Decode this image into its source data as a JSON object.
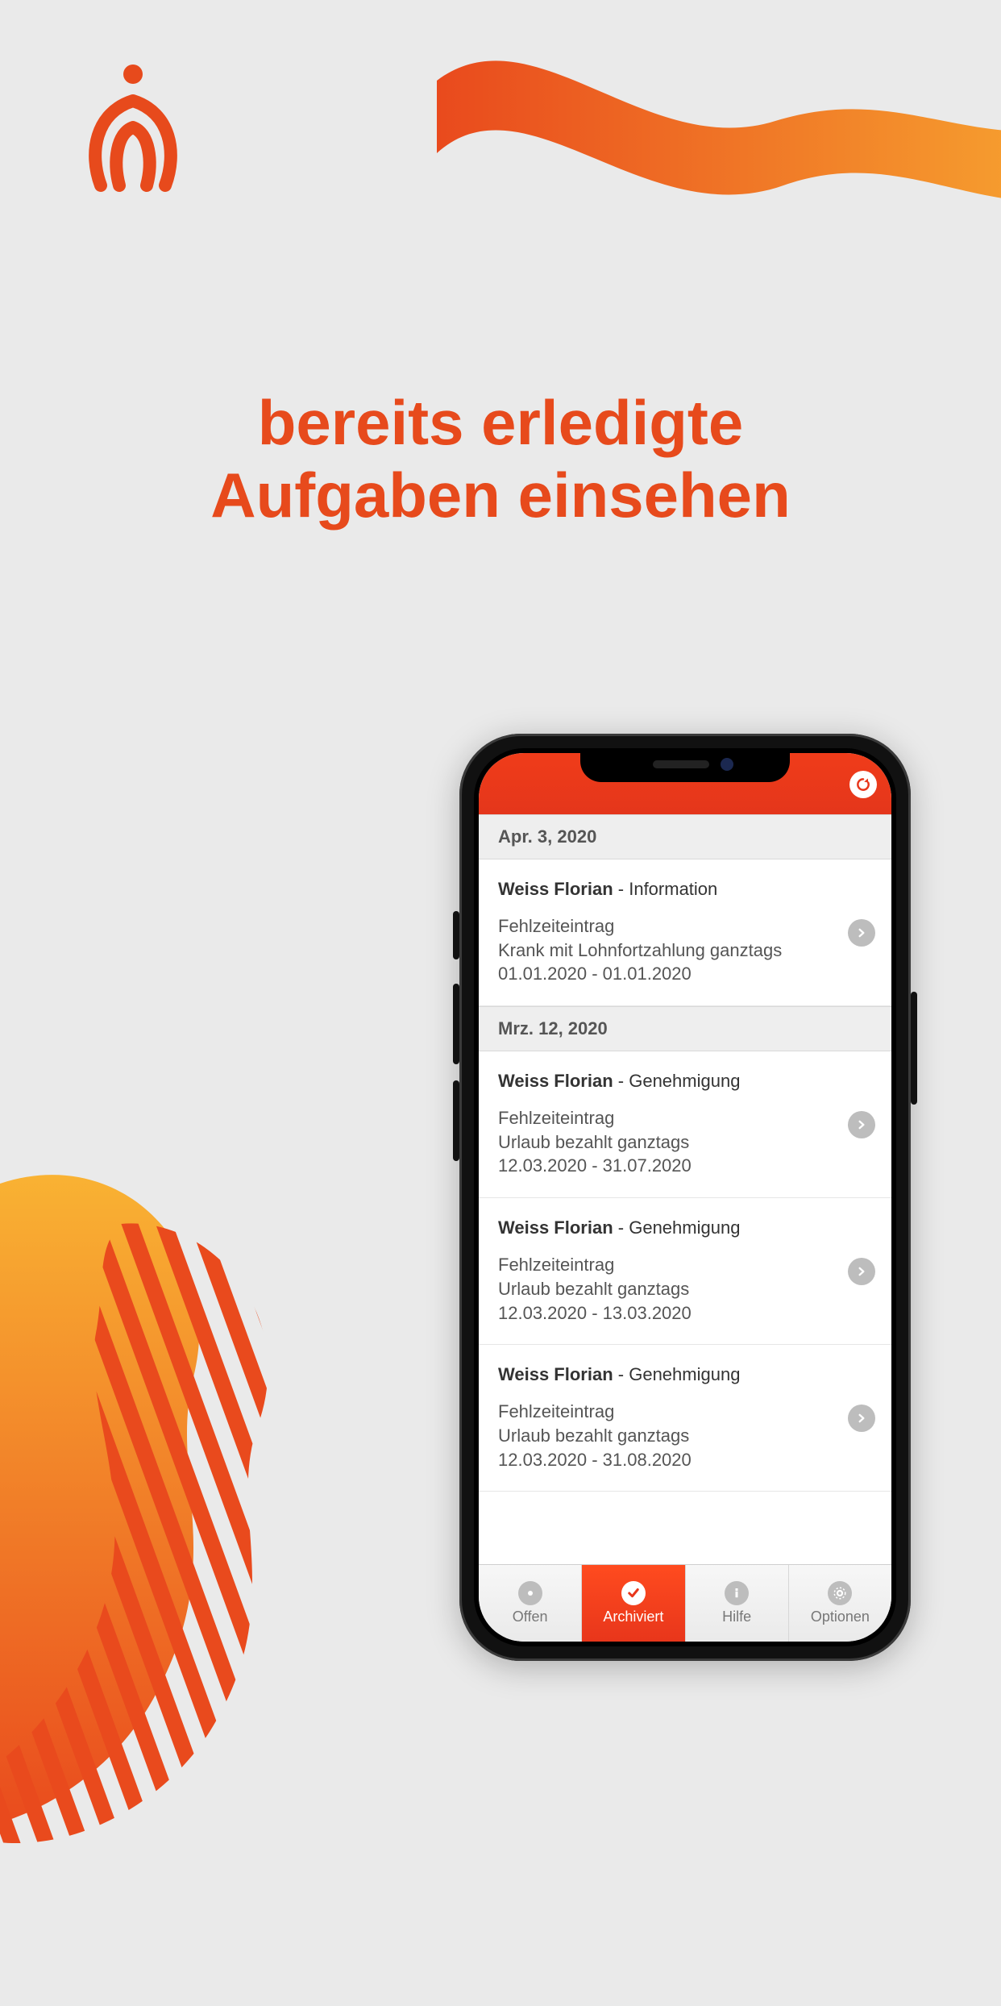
{
  "marketing": {
    "heading_line1": "bereits erledigte",
    "heading_line2": "Aufgaben einsehen"
  },
  "app": {
    "sections": [
      {
        "date": "Apr. 3, 2020",
        "items": [
          {
            "name": "Weiss Florian",
            "type": "Information",
            "line1": "Fehlzeiteintrag",
            "line2": "Krank mit Lohnfortzahlung ganztags",
            "line3": "01.01.2020 - 01.01.2020"
          }
        ]
      },
      {
        "date": "Mrz. 12, 2020",
        "items": [
          {
            "name": "Weiss Florian",
            "type": "Genehmigung",
            "line1": "Fehlzeiteintrag",
            "line2": "Urlaub bezahlt ganztags",
            "line3": "12.03.2020 - 31.07.2020"
          },
          {
            "name": "Weiss Florian",
            "type": "Genehmigung",
            "line1": "Fehlzeiteintrag",
            "line2": "Urlaub bezahlt ganztags",
            "line3": "12.03.2020 - 13.03.2020"
          },
          {
            "name": "Weiss Florian",
            "type": "Genehmigung",
            "line1": "Fehlzeiteintrag",
            "line2": "Urlaub bezahlt ganztags",
            "line3": "12.03.2020 - 31.08.2020"
          }
        ]
      }
    ],
    "tabs": {
      "open": "Offen",
      "archived": "Archiviert",
      "help": "Hilfe",
      "options": "Optionen"
    }
  }
}
